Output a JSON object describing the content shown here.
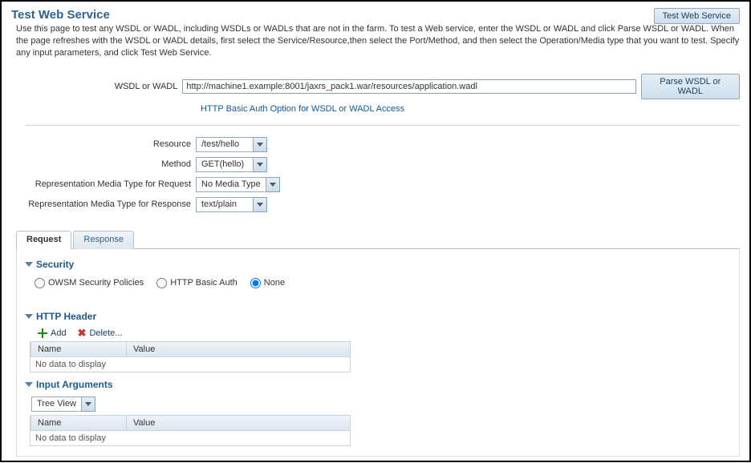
{
  "header": {
    "title": "Test Web Service",
    "test_btn": "Test Web Service",
    "intro": "Use this page to test any WSDL or WADL, including WSDLs or WADLs that are not in the farm. To test a Web service, enter the WSDL or WADL and click Parse WSDL or WADL. When the page refreshes with the WSDL or WADL details, first select the Service/Resource,then select the Port/Method, and then select the Operation/Media type that you want to test. Specify any input parameters, and click Test Web Service."
  },
  "wsdl": {
    "label": "WSDL or WADL",
    "value": "http://machine1.example:8001/jaxrs_pack1.war/resources/application.wadl",
    "parse_btn": "Parse WSDL or WADL",
    "auth_link": "HTTP Basic Auth Option for WSDL or WADL Access"
  },
  "selects": {
    "resource": {
      "label": "Resource",
      "value": "/test/hello"
    },
    "method": {
      "label": "Method",
      "value": "GET(hello)"
    },
    "req_media": {
      "label": "Representation Media Type for Request",
      "value": "No Media Type"
    },
    "res_media": {
      "label": "Representation Media Type for Response",
      "value": "text/plain"
    }
  },
  "tabs": {
    "request": "Request",
    "response": "Response"
  },
  "security": {
    "title": "Security",
    "owsm": "OWSM Security Policies",
    "basic": "HTTP Basic Auth",
    "none": "None"
  },
  "http_header": {
    "title": "HTTP Header",
    "add": "Add",
    "delete": "Delete...",
    "col_name": "Name",
    "col_value": "Value",
    "empty": "No data to display"
  },
  "input_args": {
    "title": "Input Arguments",
    "view": "Tree View",
    "col_name": "Name",
    "col_value": "Value",
    "empty": "No data to display"
  }
}
